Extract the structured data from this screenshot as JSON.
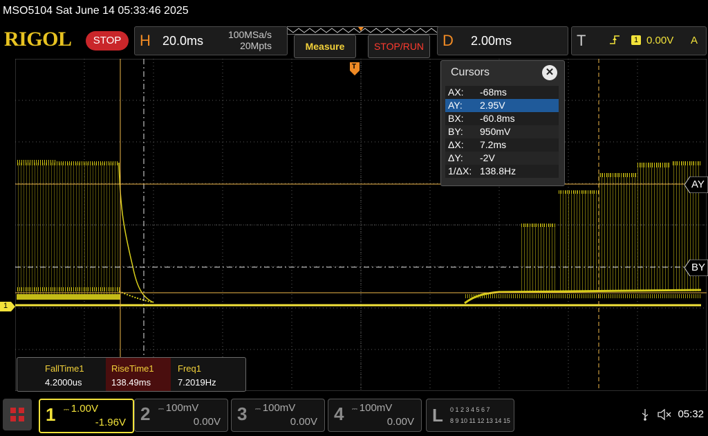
{
  "status": {
    "text": "MSO5104  Sat June 14 05:33:46 2025"
  },
  "top": {
    "logo": "RIGOL",
    "run_state": "STOP",
    "horizontal": {
      "letter": "H",
      "timebase": "20.0ms",
      "rate": "100MSa/s",
      "depth": "20Mpts"
    },
    "measure_label": "Measure",
    "stop_run_label": "STOP/RUN",
    "delay": {
      "letter": "D",
      "value": "2.00ms"
    },
    "trigger": {
      "letter": "T",
      "source": "1",
      "level": "0.00V",
      "mode": "A"
    }
  },
  "cursors": {
    "title": "Cursors",
    "close": "✕",
    "rows": [
      {
        "k": "AX:",
        "v": "-68ms"
      },
      {
        "k": "AY:",
        "v": "2.95V"
      },
      {
        "k": "BX:",
        "v": "-60.8ms"
      },
      {
        "k": "BY:",
        "v": "950mV"
      },
      {
        "k": "ΔX:",
        "v": "7.2ms"
      },
      {
        "k": "ΔY:",
        "v": "-2V"
      },
      {
        "k": "1/ΔX:",
        "v": "138.8Hz"
      }
    ],
    "selected_row": 1,
    "tag_ay": "AY",
    "tag_by": "BY",
    "ch_marker": "1",
    "trig_marker": "T"
  },
  "measurements": [
    {
      "name": "FallTime1",
      "value": "4.2000us"
    },
    {
      "name": "RiseTime1",
      "value": "138.49ms"
    },
    {
      "name": "Freq1",
      "value": "7.2019Hz"
    }
  ],
  "channels": [
    {
      "num": "1",
      "scale": "1.00V",
      "offset": "-1.96V",
      "color": "#f2e23a"
    },
    {
      "num": "2",
      "scale": "100mV",
      "offset": "0.00V",
      "color": "#9a9a9a"
    },
    {
      "num": "3",
      "scale": "100mV",
      "offset": "0.00V",
      "color": "#9a9a9a"
    },
    {
      "num": "4",
      "scale": "100mV",
      "offset": "0.00V",
      "color": "#9a9a9a"
    }
  ],
  "la": {
    "letter": "L",
    "row1": "0 1 2 3  4 5 6 7",
    "row2": "8 9 10 11 12 13 14 15"
  },
  "clock": "05:32",
  "colors": {
    "trace": "#e9df1f",
    "cursor": "#f0b84a",
    "accent": "#f08a24"
  }
}
